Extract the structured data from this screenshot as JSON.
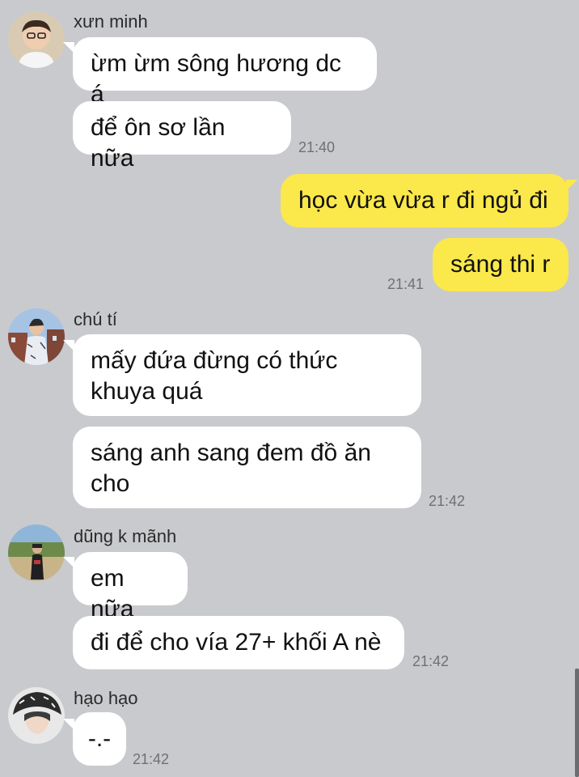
{
  "messages": {
    "g1": {
      "sender": "xưn minh",
      "m1": "ừm ừm sông hương dc á",
      "m2": "để ôn sơ lần nữa",
      "time": "21:40"
    },
    "g2": {
      "m1": "học vừa vừa r đi ngủ đi",
      "m2": "sáng thi r",
      "time": "21:41"
    },
    "g3": {
      "sender": "chú tí",
      "m1": "mấy đứa đừng có thức khuya quá",
      "m2": "sáng anh sang đem đồ ăn cho",
      "time": "21:42"
    },
    "g4": {
      "sender": "dũng k mãnh",
      "m1": "em nữa",
      "m2": "đi để cho vía 27+ khối A nè",
      "time": "21:42"
    },
    "g5": {
      "sender": "hạo hạo",
      "m1": "-.-",
      "time": "21:42"
    }
  },
  "colors": {
    "background": "#c9cacd",
    "incoming_bubble": "#ffffff",
    "outgoing_bubble": "#fbe84a",
    "timestamp": "#6f7074"
  }
}
